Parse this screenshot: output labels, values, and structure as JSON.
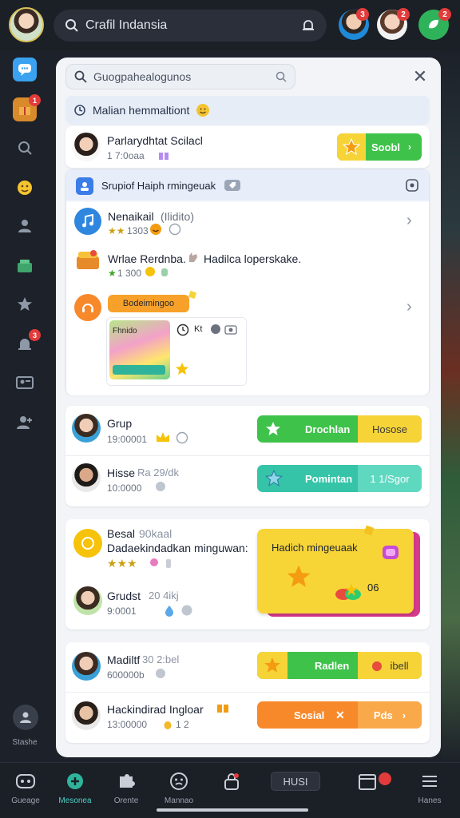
{
  "header": {
    "search_text": "Crafil Indansia",
    "badges": [
      "3",
      "2",
      "2"
    ]
  },
  "rail": {
    "badges": [
      "1",
      "3"
    ],
    "status_label": "Stashe"
  },
  "modal": {
    "search_text": "Guogpahealogunos",
    "banner_text": "Malian hemmaltiont",
    "top_row": {
      "name": "Parlarydhtat Scilacl",
      "sub": "1 7:0oaa",
      "button_label": "Soobl"
    },
    "group_card": {
      "title": "Srupiof Haiph rmingeuak",
      "items": [
        {
          "name": "Nenaikail",
          "name_extra": "(Ilidito)",
          "sub": "1303"
        },
        {
          "name": "Wrlae Rerdnba.",
          "name_extra": "Hadilca loperskake.",
          "sub": "1 300"
        },
        {
          "tag": "Bodeimingoo",
          "tile_label": "Fhnido",
          "tile_code": "Kt"
        }
      ]
    },
    "friends_a": [
      {
        "name": "Grup",
        "sub": "19:00001",
        "left_label": "Drochlan",
        "right_label": "Hosose"
      },
      {
        "name": "Hisse",
        "name_extra": "Ra 29/dk",
        "sub": "10:0000",
        "left_label": "Pomintan",
        "right_label": "1 1/Sgor"
      }
    ],
    "reward_card": {
      "name": "Besal",
      "name_extra": "90kaal",
      "line2": "Dadaekindadkan minguwan:",
      "second_name": "Grudst",
      "second_extra": "20 4ikj",
      "second_sub": "9:0001",
      "promo_title": "Hadich mingeuaak",
      "promo_count": "06"
    },
    "friends_b": [
      {
        "name": "Madiltf",
        "name_extra": "30 2:bel",
        "sub": "600000b",
        "left_label": "Radlen",
        "right_label": "ibell"
      },
      {
        "name": "Hackindirad Ingloar",
        "sub": "13:00000",
        "sub_extra": "1 2",
        "left_label": "Sosial",
        "right_label": "Pds"
      }
    ]
  },
  "bottom_nav": [
    {
      "label": "Gueage"
    },
    {
      "label": "Mesonea"
    },
    {
      "label": "Orente"
    },
    {
      "label": "Mannao"
    },
    {
      "label": ""
    },
    {
      "label": "HUSI"
    },
    {
      "label": ""
    },
    {
      "label": "Hanes"
    }
  ],
  "colors": {
    "green": "#3fc24a",
    "yellow": "#f6d438",
    "teal": "#36c4a8",
    "orange": "#f7892b",
    "badge": "#e23b3b"
  }
}
